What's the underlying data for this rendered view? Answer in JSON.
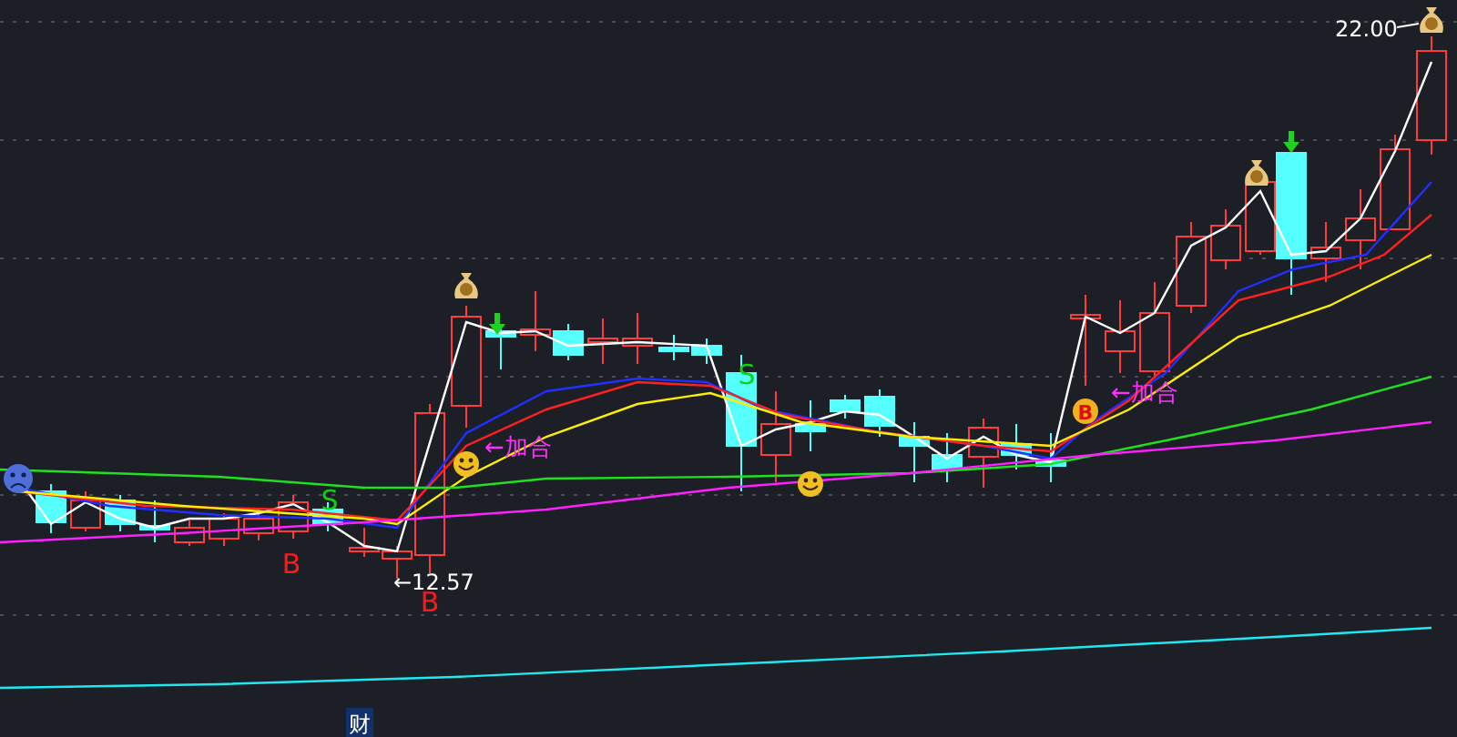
{
  "chart": {
    "price_high": "22.00",
    "price_low": "←12.57",
    "markers": [
      {
        "kind": "sell",
        "text": "S"
      },
      {
        "kind": "sell",
        "text": "S"
      },
      {
        "kind": "buy",
        "text": "B"
      },
      {
        "kind": "buy",
        "text": "B"
      },
      {
        "kind": "note",
        "text": "←加合"
      },
      {
        "kind": "note",
        "text": "←加合"
      },
      {
        "kind": "badge",
        "text": "B"
      }
    ]
  },
  "footer": {
    "tag": "财"
  }
}
